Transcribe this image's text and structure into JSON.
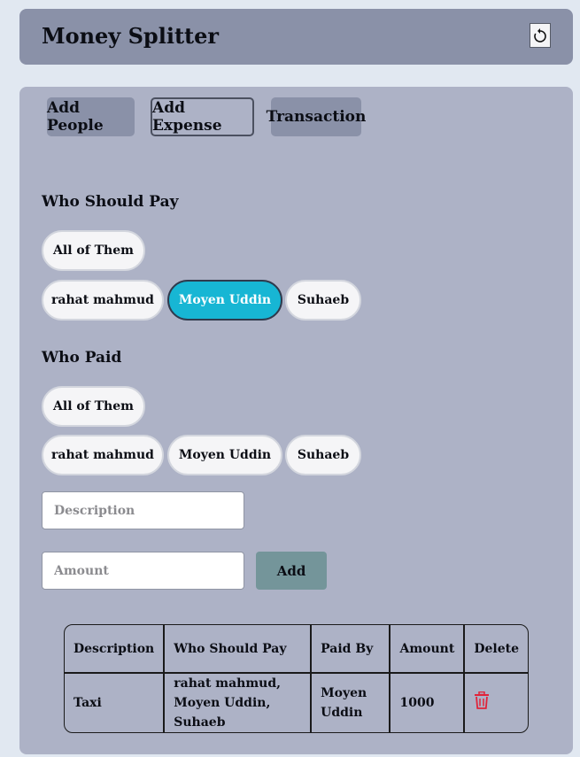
{
  "app": {
    "title": "Money Splitter"
  },
  "tabs": [
    {
      "label": "Add People"
    },
    {
      "label": "Add Expense"
    },
    {
      "label": "Transaction"
    }
  ],
  "should_pay": {
    "title": "Who Should Pay",
    "all_label": "All of Them",
    "people": [
      "rahat mahmud",
      "Moyen Uddin",
      "Suhaeb"
    ],
    "selected": [
      "Moyen Uddin"
    ]
  },
  "paid": {
    "title": "Who Paid",
    "all_label": "All of Them",
    "people": [
      "rahat mahmud",
      "Moyen Uddin",
      "Suhaeb"
    ]
  },
  "form": {
    "description_placeholder": "Description",
    "amount_placeholder": "Amount",
    "add_label": "Add"
  },
  "table": {
    "headers": [
      "Description",
      "Who Should Pay",
      "Paid By",
      "Amount",
      "Delete"
    ],
    "rows": [
      {
        "description": "Taxi",
        "who_should_pay": "rahat mahmud, Moyen Uddin, Suhaeb",
        "paid_by": "Moyen Uddin",
        "amount": "1000"
      }
    ]
  },
  "colors": {
    "selected_pill": "#17b6d4",
    "delete_icon": "#e0243a",
    "add_button": "#74959a"
  }
}
